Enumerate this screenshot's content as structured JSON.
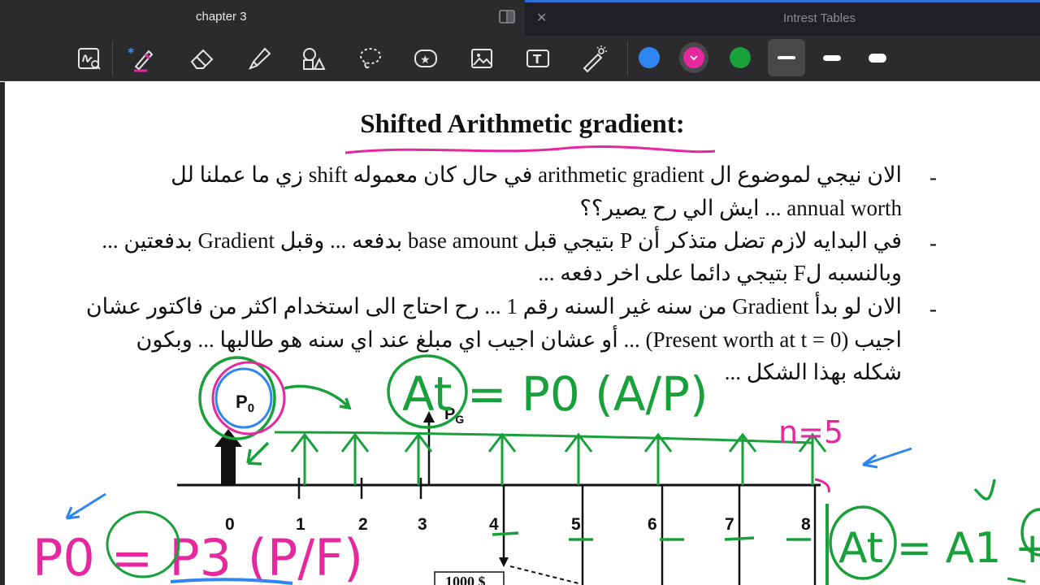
{
  "tabs": [
    {
      "title": "chapter 3",
      "active": true
    },
    {
      "title": "Intrest Tables",
      "active": false
    }
  ],
  "tab_icons": {
    "split": "split-view-icon",
    "close": "✕"
  },
  "toolbar": {
    "tools": [
      "ink-to-text-icon",
      "pen-icon",
      "eraser-icon",
      "highlighter-icon",
      "shapes-icon",
      "lasso-icon",
      "sticker-icon",
      "image-icon",
      "text-box-icon",
      "laser-pointer-icon"
    ],
    "colors": [
      "#2f86f2",
      "#e6289e",
      "#18a03a"
    ],
    "selected_color": "#e6289e",
    "stroke_widths": [
      "thin",
      "medium",
      "thick"
    ],
    "selected_width": "thin"
  },
  "document": {
    "title": "Shifted Arithmetic gradient:",
    "lines": [
      "الان نيجي لموضوع ال arithmetic gradient في حال كان معموله shift زي ما عملنا لل",
      "annual worth ... ايش الي رح يصير؟؟",
      "في البدايه لازم تضل متذكر أن P بتيجي قبل base amount بدفعه ... وقبل Gradient بدفعتين ...",
      "وبالنسبه لF بتيجي دائما على اخر دفعه ...",
      "الان لو بدأ Gradient من سنه غير السنه رقم 1 ... رح احتاج الى استخدام اكثر من فاكتور عشان",
      "اجيب (Present worth at t = 0) ... أو عشان اجيب اي مبلغ عند اي سنه هو طالبها ... وبكون",
      "شكله بهذا الشكل ..."
    ],
    "diagram": {
      "p0_label": "P",
      "p0_sub": "0",
      "pg_label": "P",
      "pg_sub": "G",
      "ticks": [
        "0",
        "1",
        "2",
        "3",
        "4",
        "5",
        "6",
        "7",
        "8"
      ],
      "bottom_value": "1000 $"
    },
    "handwriting": {
      "green_top": "At = P0 (A/P)",
      "pink_n": "n=5",
      "pink_bottom": "P0 = P3 (P/F)",
      "green_right": "At = A1 +"
    }
  }
}
